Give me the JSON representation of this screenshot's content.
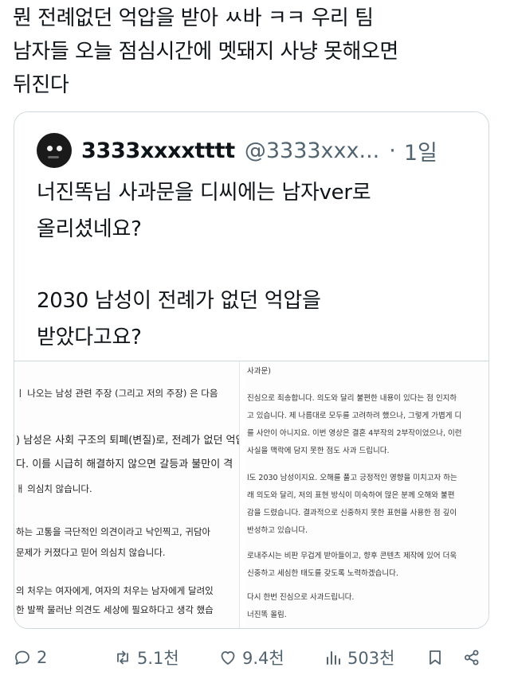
{
  "tweet": {
    "lines": [
      "뭔 전례없던 억압을 받아 ㅆ바 ㅋㅋ 우리 팀",
      "남자들 오늘 점심시간에 멧돼지 사냥 못해오면",
      "뒤진다"
    ]
  },
  "quote": {
    "display_name": "3333xxxxtttt",
    "handle": "@3333xxx...",
    "separator": "·",
    "time": "1일",
    "text_lines": [
      "너진똑님 사과문을 디씨에는 남자ver로",
      "올리셨네요?",
      "2030 남성이 전례가 없던 억압을",
      "받았다고요?"
    ],
    "media": {
      "left_doc_lines": [
        "ㅣ 나오는 남성 관련 주장 (그리고 저의 주장) 은 다음",
        ") 남성은 사회 구조의 퇴폐(변질)로, 전례가 없던 억압",
        "다. 이를 시급히 해결하지 않으면 갈등과 불만이 격",
        "ㅐ 의심치 않습니다.",
        "하는 고통을 극단적인 의견이라고 낙인찍고, 귀담아",
        "문제가 커졌다고 믿어 의심치 않습니다.",
        "의 처우는 여자에게, 여자의 처우는 남자에게 달려있",
        "한 발짝 물러난 의견도 세상에 필요하다고 생각 했습"
      ],
      "right_doc_lines": [
        "사과문)",
        "진심으로 죄송합니다. 의도와 달리 불편한 내용이 있다는 점 인지하",
        "고 있습니다. 제 나름대로 모두를 고려하려 했으나, 그렇게 가볍게 디",
        "를 사안이 아니지요. 이번 영상은 결혼 4부작의 2부작이었으나, 이런",
        "사실을 맥락에 담지 못한 점도 사과 드립니다.",
        "l도 2030 남성이지요. 오해를 풀고 긍정적인 영향을 미치고자 하는",
        "래 의도와 달리, 저의 표현 방식이 미숙하여 많은 분께 오해와 불편",
        "감을 드렸습니다. 결과적으로 신중하지 못한 표현을 사용한 점 깊이",
        "반성하고 있습니다.",
        "로내주시는 비판 무겁게 받아들이고, 향후 콘텐츠 제작에 있어 더욱",
        "신중하고 세심한 태도를 갖도록 노력하겠습니다.",
        "다시 한번 진심으로 사과드립니다.",
        "너진똑 올림."
      ]
    }
  },
  "actions": {
    "reply_count": "2",
    "retweet_count": "5.1천",
    "like_count": "9.4천",
    "views_count": "503천"
  },
  "icons": {
    "reply": "reply-icon",
    "retweet": "retweet-icon",
    "like": "heart-icon",
    "views": "views-icon",
    "bookmark": "bookmark-icon",
    "share": "share-icon"
  }
}
